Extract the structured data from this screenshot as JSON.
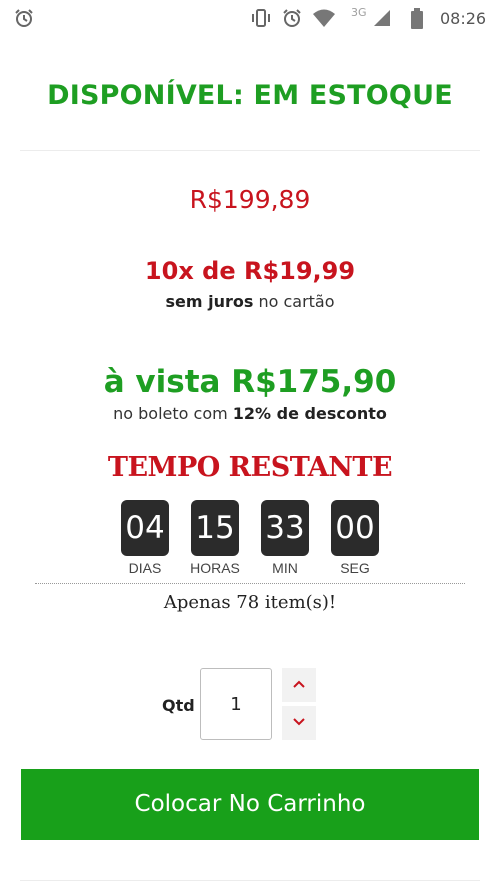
{
  "status_bar": {
    "time": "08:26",
    "network": "3G",
    "icons": [
      "alarm-icon",
      "vibrate-icon",
      "alarm-icon",
      "wifi-icon",
      "signal-icon",
      "battery-icon"
    ]
  },
  "product": {
    "availability": "DISPONÍVEL: EM ESTOQUE",
    "price_regular": "R$199,89",
    "installments": "10x de R$19,99",
    "installments_note_bold": "sem juros",
    "installments_note_rest": " no cartão",
    "cash_price": "à vista R$175,90",
    "cash_note_pre": "no boleto com ",
    "cash_note_bold": "12% de desconto"
  },
  "countdown": {
    "title": "TEMPO RESTANTE",
    "days": "04",
    "hours": "15",
    "minutes": "33",
    "seconds": "00",
    "label_days": "DIAS",
    "label_hours": "HORAS",
    "label_minutes": "MIN",
    "label_seconds": "SEG"
  },
  "stock_message": "Apenas 78 item(s)!",
  "quantity": {
    "label": "Qtd",
    "value": "1"
  },
  "cart_button": {
    "label": "Colocar No Carrinho"
  },
  "colors": {
    "green": "#1e9e22",
    "red": "#c8141e",
    "button_green": "#18a01a",
    "countdown_bg": "#2b2b2b"
  }
}
